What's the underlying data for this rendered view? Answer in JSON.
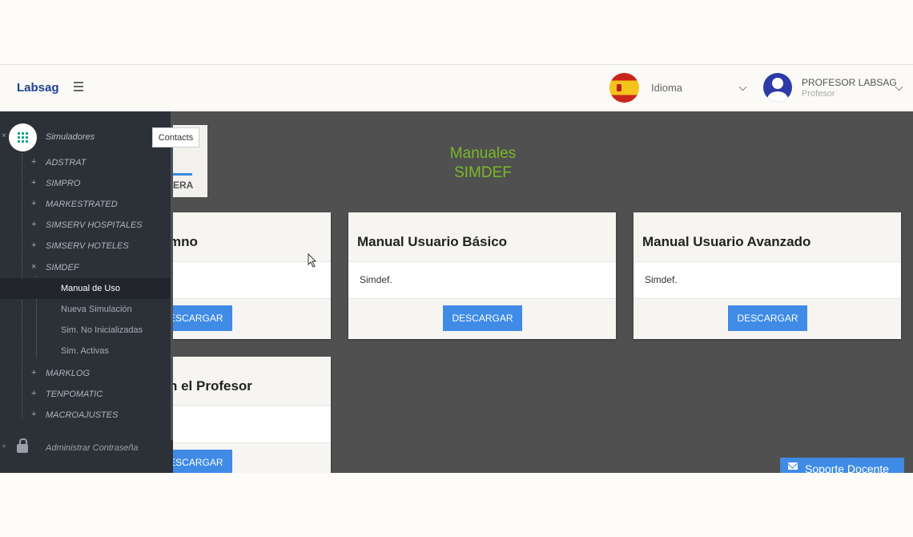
{
  "header": {
    "brand": "Labsag",
    "language_label": "Idioma",
    "user_name": "PROFESOR LABSAG",
    "user_role": "Profesor"
  },
  "sidebar": {
    "main_label": "Simuladores",
    "tooltip": "Contacts",
    "items": [
      {
        "sign": "+",
        "label": "ADSTRAT"
      },
      {
        "sign": "+",
        "label": "SIMPRO"
      },
      {
        "sign": "+",
        "label": "MARKESTRATED"
      },
      {
        "sign": "+",
        "label": "SIMSERV HOSPITALES"
      },
      {
        "sign": "+",
        "label": "SIMSERV HOTELES"
      },
      {
        "sign": "×",
        "label": "SIMDEF"
      }
    ],
    "subitems": [
      {
        "label": "Manual de Uso",
        "active": true
      },
      {
        "label": "Nueva Simulación"
      },
      {
        "label": "Sim. No Inicializadas"
      },
      {
        "label": "Sim. Activas"
      }
    ],
    "items_after": [
      {
        "sign": "+",
        "label": "MARKLOG"
      },
      {
        "sign": "+",
        "label": "TENPOMATIC"
      },
      {
        "sign": "+",
        "label": "MACROAJUSTES"
      }
    ],
    "password_label": "Administrar Contraseña"
  },
  "main": {
    "title_line1": "Manuales",
    "title_line2": "SIMDEF",
    "tab_partial": "ERA",
    "cards": [
      {
        "title": "mno",
        "desc": "",
        "button": "DESCARGAR"
      },
      {
        "title": "Manual Usuario Básico",
        "desc": "Simdef.",
        "button": "DESCARGAR"
      },
      {
        "title": "Manual Usuario Avanzado",
        "desc": "Simdef.",
        "button": "DESCARGAR"
      },
      {
        "title": "n el Profesor",
        "desc": "",
        "button": "DESCARGAR"
      }
    ],
    "support_label": "Soporte Docente"
  },
  "colors": {
    "accent": "#3f8be6",
    "brand": "#1f3f9a",
    "title_green": "#7ab82a",
    "sidebar_bg": "#2c3138",
    "content_bg": "#505050"
  },
  "icons": {
    "menu": "hamburger-icon",
    "language": "spain-flag-icon",
    "user": "user-avatar-icon",
    "apps": "grid-icon",
    "password": "lock-icon",
    "support": "mail-icon"
  }
}
